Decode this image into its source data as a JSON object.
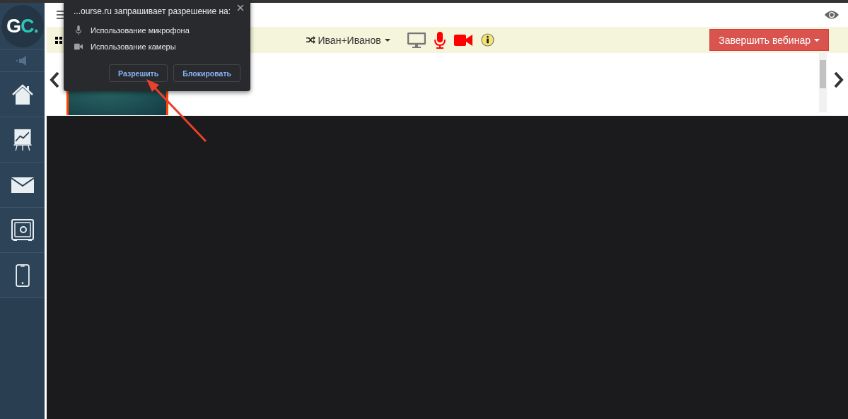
{
  "sidebar": {
    "logo": [
      "G",
      "C."
    ],
    "items": [
      {
        "kind": "sound"
      },
      {
        "kind": "home"
      },
      {
        "kind": "chart"
      },
      {
        "kind": "mail"
      },
      {
        "kind": "safe"
      },
      {
        "kind": "phone"
      }
    ]
  },
  "toolbar": {
    "user": "Иван+Иванов",
    "end_button": "Завершить вебинар"
  },
  "permission_popup": {
    "title": "...ourse.ru запрашивает разрешение на:",
    "permissions": [
      {
        "kind": "microphone",
        "label": "Использование микрофона"
      },
      {
        "kind": "camera",
        "label": "Использование камеры"
      }
    ],
    "buttons": [
      "Разрешить",
      "Блокировать"
    ]
  }
}
